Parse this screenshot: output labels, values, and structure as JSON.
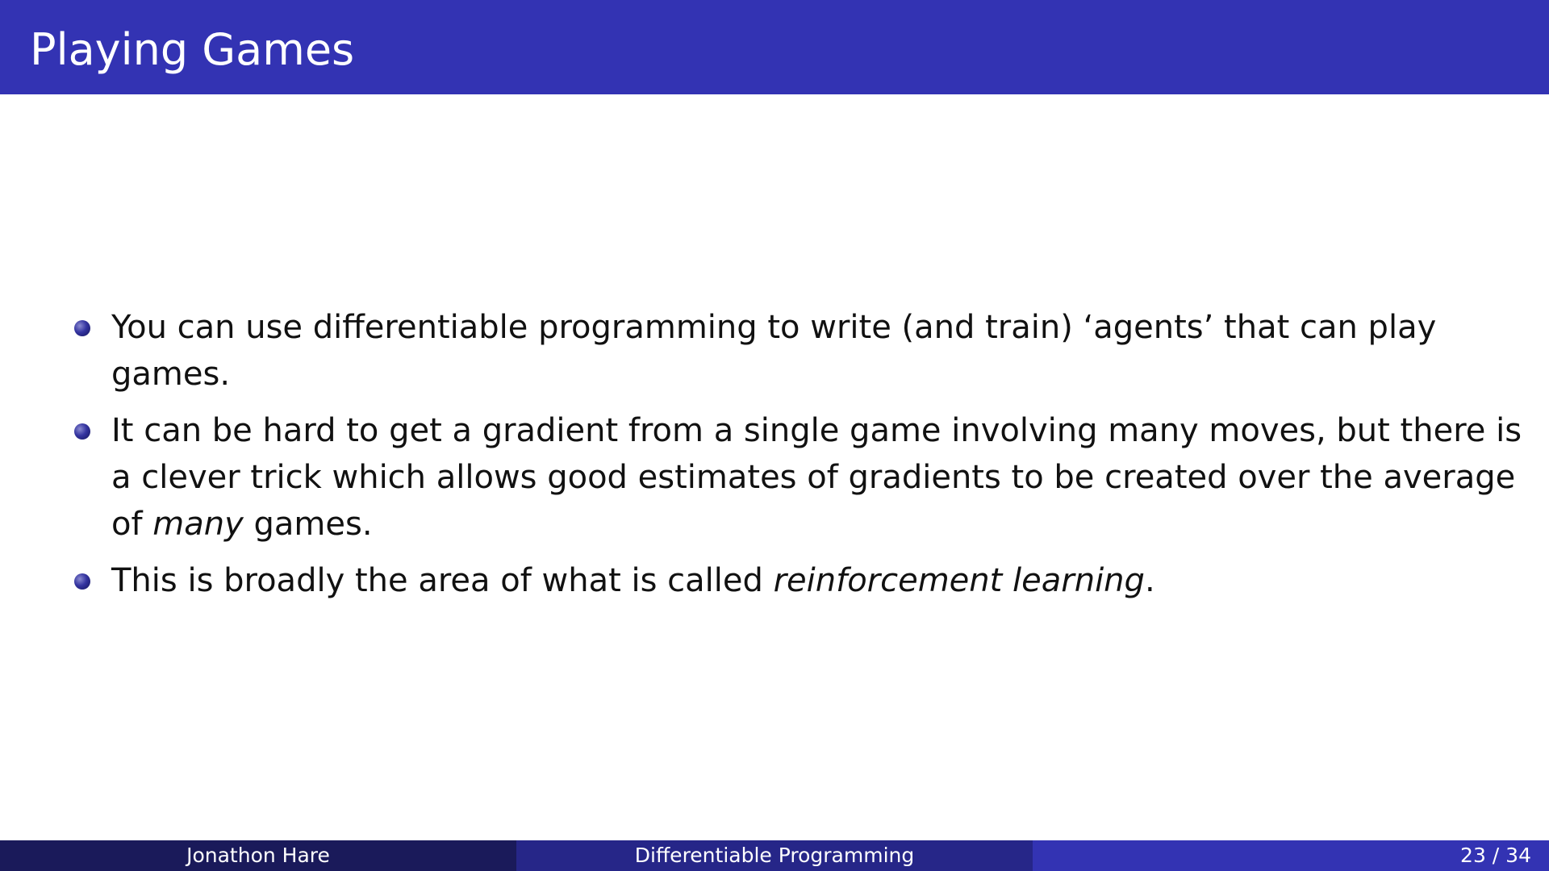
{
  "slide": {
    "title": "Playing Games",
    "bullets": [
      {
        "text": "You can use differentiable programming to write (and train) ‘agents’ that can play games."
      },
      {
        "text": "It can be hard to get a gradient from a single game involving many moves, but there is a clever trick which allows good estimates of gradients to be created over the average of ",
        "emphasis": "many",
        "after": " games."
      },
      {
        "text": "This is broadly the area of what is called ",
        "emphasis": "reinforcement learning",
        "after": "."
      }
    ]
  },
  "footer": {
    "author": "Jonathon Hare",
    "talk_title": "Differentiable Programming",
    "page": "23 / 34"
  },
  "colors": {
    "title_bar": "#3333b3",
    "footer_left": "#1a1a5a",
    "footer_middle": "#262688",
    "footer_right": "#3333b3"
  }
}
